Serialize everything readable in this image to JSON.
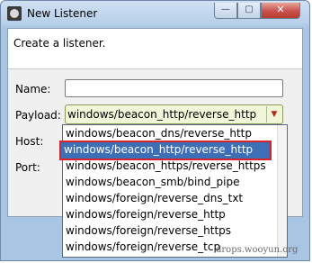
{
  "window": {
    "title": "New Listener",
    "buttons": {
      "minimize": "—",
      "maximize": "▢",
      "close": "✕"
    }
  },
  "banner": {
    "text": "Create a listener."
  },
  "form": {
    "name_label": "Name:",
    "name_value": "",
    "payload_label": "Payload:",
    "payload_value": "windows/beacon_http/reverse_http",
    "host_label": "Host:",
    "port_label": "Port:"
  },
  "dropdown": {
    "items": [
      "windows/beacon_dns/reverse_http",
      "windows/beacon_http/reverse_http",
      "windows/beacon_https/reverse_https",
      "windows/beacon_smb/bind_pipe",
      "windows/foreign/reverse_dns_txt",
      "windows/foreign/reverse_http",
      "windows/foreign/reverse_https",
      "windows/foreign/reverse_tcp"
    ],
    "selected_index": 1
  },
  "watermark": "drops.wooyun.org",
  "colors": {
    "selection": "#3d6fb7",
    "highlight_border": "#d8232a",
    "combo_bg": "#f2f6d8"
  }
}
